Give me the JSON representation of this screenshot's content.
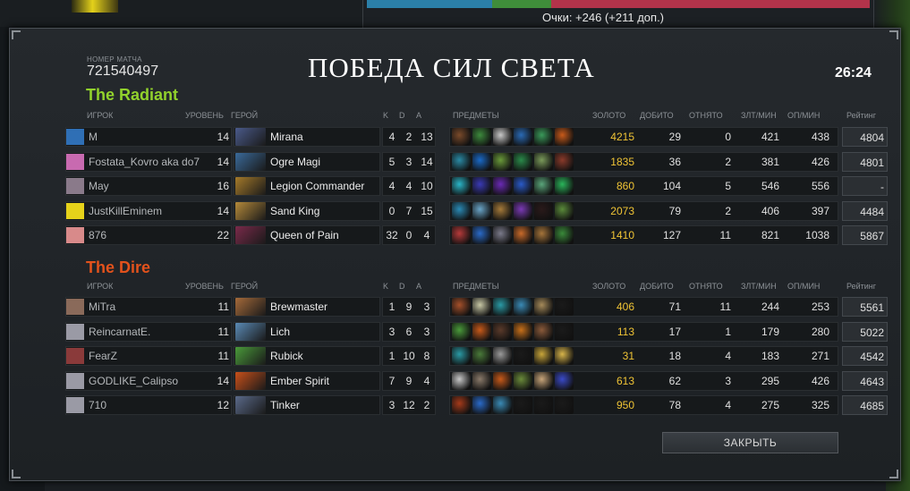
{
  "points_line": "Очки: +246 (+211 доп.)",
  "match": {
    "label": "НОМЕР МАТЧА",
    "id": "721540497",
    "result": "ПОБЕДА СИЛ СВЕТА",
    "duration": "26:24"
  },
  "headers": {
    "player": "ИГРОК",
    "level": "УРОВЕНЬ",
    "hero": "ГЕРОЙ",
    "k": "K",
    "d": "D",
    "a": "A",
    "items": "ПРЕДМЕТЫ",
    "gold": "ЗОЛОТО",
    "lh": "ДОБИТО",
    "dn": "ОТНЯТО",
    "gpm": "ЗЛТ/МИН",
    "xpm": "ОП/МИН",
    "rating": "Рейтинг"
  },
  "radiant": {
    "title": "The Radiant",
    "color": "#92d22c",
    "players": [
      {
        "name": "M",
        "level": "14",
        "hero": "Mirana",
        "k": "4",
        "d": "2",
        "a": "13",
        "gold": "4215",
        "lh": "29",
        "dn": "0",
        "gpm": "421",
        "xpm": "438",
        "rating": "4804",
        "avatar": "#2f6fb5",
        "hero_color": "#4a5a8a",
        "items": [
          "#7a4a2a",
          "#3d8a3d",
          "#c8c8c8",
          "#2a6ab5",
          "#3a9a5a",
          "#c85a1a"
        ]
      },
      {
        "name": "Fostata_Kovro aka do7",
        "level": "14",
        "hero": "Ogre Magi",
        "k": "5",
        "d": "3",
        "a": "14",
        "gold": "1835",
        "lh": "36",
        "dn": "2",
        "gpm": "381",
        "xpm": "426",
        "rating": "4801",
        "avatar": "#c86ab0",
        "hero_color": "#3a6a9a",
        "items": [
          "#2a8aa5",
          "#1a6ac8",
          "#6a9a3a",
          "#2a8a4a",
          "#7a9a5a",
          "#8a3a2a"
        ]
      },
      {
        "name": "May",
        "level": "16",
        "hero": "Legion Commander",
        "k": "4",
        "d": "4",
        "a": "10",
        "gold": "860",
        "lh": "104",
        "dn": "5",
        "gpm": "546",
        "xpm": "556",
        "rating": "-",
        "avatar": "#8a7a8a",
        "hero_color": "#a57a2a",
        "items": [
          "#2ab5c8",
          "#3a3ab5",
          "#6a2ab5",
          "#2a5ac8",
          "#5aa57a",
          "#2ab55a"
        ]
      },
      {
        "name": "JustKillEminem",
        "level": "14",
        "hero": "Sand King",
        "k": "0",
        "d": "7",
        "a": "15",
        "gold": "2073",
        "lh": "79",
        "dn": "2",
        "gpm": "406",
        "xpm": "397",
        "rating": "4484",
        "avatar": "#e6d21a",
        "hero_color": "#b58a3a",
        "items": [
          "#2a8ab5",
          "#6aa5c8",
          "#a57a3a",
          "#7a3ab5",
          "#2a1a1a",
          "#5a8a3a"
        ]
      },
      {
        "name": "876",
        "level": "22",
        "hero": "Queen of Pain",
        "k": "32",
        "d": "0",
        "a": "4",
        "gold": "1410",
        "lh": "127",
        "dn": "11",
        "gpm": "821",
        "xpm": "1038",
        "rating": "5867",
        "avatar": "#d88a8a",
        "hero_color": "#7a2a4a",
        "items": [
          "#b53a3a",
          "#2a6ac8",
          "#7a7a8a",
          "#c86a2a",
          "#a5743a",
          "#3a8a3a"
        ]
      }
    ]
  },
  "dire": {
    "title": "The Dire",
    "color": "#e3521c",
    "players": [
      {
        "name": "MiTra",
        "level": "11",
        "hero": "Brewmaster",
        "k": "1",
        "d": "9",
        "a": "3",
        "gold": "406",
        "lh": "71",
        "dn": "11",
        "gpm": "244",
        "xpm": "253",
        "rating": "5561",
        "avatar": "#8a6a5a",
        "hero_color": "#a56a3a",
        "items": [
          "#a5502a",
          "#c8c8a5",
          "#2a9aa5",
          "#3a8ab5",
          "#a58a5a",
          "#1a1a1a"
        ]
      },
      {
        "name": "ReincarnatE.",
        "level": "11",
        "hero": "Lich",
        "k": "3",
        "d": "6",
        "a": "3",
        "gold": "113",
        "lh": "17",
        "dn": "1",
        "gpm": "179",
        "xpm": "280",
        "rating": "5022",
        "avatar": "#9a9aa5",
        "hero_color": "#5a8ab5",
        "items": [
          "#4a9a3a",
          "#c85a1a",
          "#5a3a2a",
          "#c8701a",
          "#8a5a3a",
          "#1a1a1a"
        ]
      },
      {
        "name": "FearZ",
        "level": "11",
        "hero": "Rubick",
        "k": "1",
        "d": "10",
        "a": "8",
        "gold": "31",
        "lh": "18",
        "dn": "4",
        "gpm": "183",
        "xpm": "271",
        "rating": "4542",
        "avatar": "#8a3a3a",
        "hero_color": "#4a9a3a",
        "items": [
          "#2a9aa5",
          "#4a7a3a",
          "#9a9a9a",
          "#1a1a1a",
          "#c8a53a",
          "#d8b54a"
        ]
      },
      {
        "name": "GODLIKE_Calipso",
        "level": "14",
        "hero": "Ember Spirit",
        "k": "7",
        "d": "9",
        "a": "4",
        "gold": "613",
        "lh": "62",
        "dn": "3",
        "gpm": "295",
        "xpm": "426",
        "rating": "4643",
        "avatar": "#9a9aa5",
        "hero_color": "#c8501a",
        "items": [
          "#c8c8c8",
          "#8a7a6a",
          "#c85a1a",
          "#6a8a3a",
          "#c8a57a",
          "#3a4ac8"
        ]
      },
      {
        "name": "710",
        "level": "12",
        "hero": "Tinker",
        "k": "3",
        "d": "12",
        "a": "2",
        "gold": "950",
        "lh": "78",
        "dn": "4",
        "gpm": "275",
        "xpm": "325",
        "rating": "4685",
        "avatar": "#9a9aa5",
        "hero_color": "#5a6a8a",
        "items": [
          "#a53a1a",
          "#2a6ac8",
          "#3a8ab5",
          "#1a1a1a",
          "#1a1a1a",
          "#1a1a1a"
        ]
      }
    ]
  },
  "close_button": "ЗАКРЫТЬ"
}
